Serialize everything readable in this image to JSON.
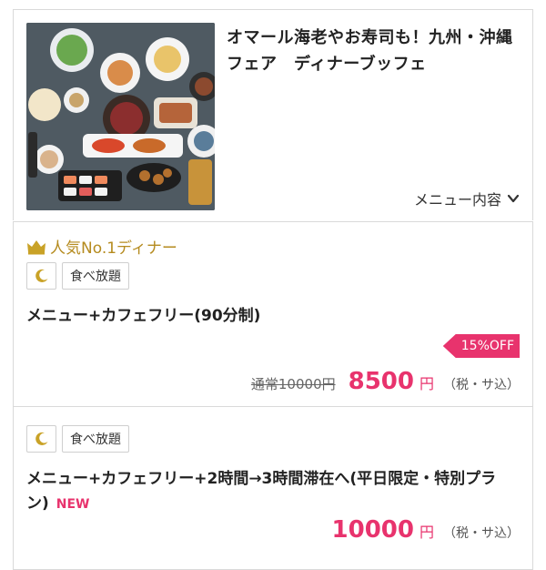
{
  "plan": {
    "title": "オマール海老やお寿司も！九州・沖縄フェア　ディナーブッフェ",
    "menu_toggle_label": "メニュー内容",
    "image_alt": "buffet food photo"
  },
  "courses": [
    {
      "rank_label": "人気No.1ディナー",
      "tags": [
        "食べ放題"
      ],
      "name": "メニュー+カフェフリー(90分制)",
      "discount": "15%OFF",
      "regular_price": "通常10000円",
      "price": "8500",
      "yen": "円",
      "tax": "（税・サ込）"
    },
    {
      "tags": [
        "食べ放題"
      ],
      "name": "メニュー+カフェフリー+2時間→3時間滞在へ(平日限定・特別プラン)",
      "new_label": "NEW",
      "price": "10000",
      "yen": "円",
      "tax": "（税・サ込）"
    }
  ],
  "colors": {
    "accent": "#e8336d",
    "gold": "#b58b1f",
    "border": "#d9d9d9"
  }
}
